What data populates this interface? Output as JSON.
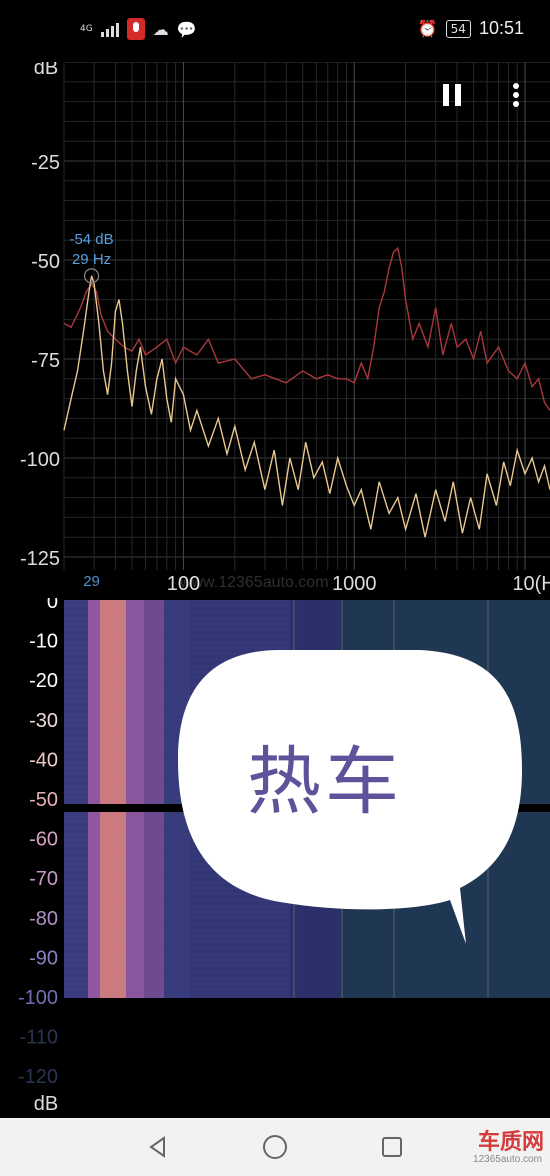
{
  "status_bar": {
    "network": "4G",
    "battery": "54",
    "time": "10:51",
    "icons": [
      "signal-icon",
      "recorder-icon",
      "qq-icon",
      "wechat-icon",
      "alarm-icon"
    ]
  },
  "toolbar": {
    "pause_icon": "pause-icon",
    "menu_icon": "more-vert-icon"
  },
  "chart_data": {
    "type": "line",
    "ylabel": "dB",
    "yticks": [
      "-25",
      "-50",
      "-75",
      "-100",
      "-125"
    ],
    "ylim": [
      0,
      -130
    ],
    "xscale": "log",
    "xticks": [
      "100",
      "1000",
      "10(Hz"
    ],
    "xlim_hz": [
      20,
      14000
    ],
    "grid": true,
    "peak": {
      "db_label": "-54 dB",
      "hz_label": "29 Hz",
      "freq_hz": 29,
      "db": -54,
      "axis_marker": "29"
    },
    "series": [
      {
        "color": "#a8383d",
        "points": [
          [
            20,
            -66
          ],
          [
            22,
            -67
          ],
          [
            25,
            -62
          ],
          [
            27,
            -58
          ],
          [
            29,
            -56
          ],
          [
            31,
            -58
          ],
          [
            33,
            -64
          ],
          [
            36,
            -68
          ],
          [
            40,
            -70
          ],
          [
            45,
            -72
          ],
          [
            50,
            -73
          ],
          [
            55,
            -70
          ],
          [
            60,
            -74
          ],
          [
            70,
            -72
          ],
          [
            80,
            -70
          ],
          [
            90,
            -76
          ],
          [
            100,
            -72
          ],
          [
            120,
            -74
          ],
          [
            140,
            -70
          ],
          [
            160,
            -76
          ],
          [
            200,
            -75
          ],
          [
            250,
            -80
          ],
          [
            300,
            -79
          ],
          [
            400,
            -81
          ],
          [
            500,
            -78
          ],
          [
            600,
            -80
          ],
          [
            700,
            -79
          ],
          [
            800,
            -80
          ],
          [
            900,
            -80
          ],
          [
            1000,
            -81
          ],
          [
            1100,
            -76
          ],
          [
            1200,
            -80
          ],
          [
            1300,
            -72
          ],
          [
            1400,
            -62
          ],
          [
            1500,
            -58
          ],
          [
            1600,
            -52
          ],
          [
            1700,
            -48
          ],
          [
            1800,
            -47
          ],
          [
            1900,
            -52
          ],
          [
            2000,
            -60
          ],
          [
            2200,
            -70
          ],
          [
            2400,
            -66
          ],
          [
            2700,
            -72
          ],
          [
            3000,
            -62
          ],
          [
            3300,
            -74
          ],
          [
            3700,
            -66
          ],
          [
            4000,
            -72
          ],
          [
            4500,
            -70
          ],
          [
            5000,
            -75
          ],
          [
            5500,
            -68
          ],
          [
            6000,
            -76
          ],
          [
            7000,
            -72
          ],
          [
            8000,
            -78
          ],
          [
            9000,
            -80
          ],
          [
            10000,
            -76
          ],
          [
            11000,
            -82
          ],
          [
            12000,
            -80
          ],
          [
            13000,
            -86
          ],
          [
            14000,
            -88
          ]
        ]
      },
      {
        "color": "#e8c890",
        "points": [
          [
            20,
            -93
          ],
          [
            22,
            -85
          ],
          [
            24,
            -78
          ],
          [
            26,
            -68
          ],
          [
            28,
            -58
          ],
          [
            29,
            -54
          ],
          [
            30,
            -56
          ],
          [
            32,
            -66
          ],
          [
            34,
            -78
          ],
          [
            36,
            -84
          ],
          [
            38,
            -76
          ],
          [
            40,
            -63
          ],
          [
            42,
            -60
          ],
          [
            44,
            -66
          ],
          [
            47,
            -78
          ],
          [
            50,
            -87
          ],
          [
            53,
            -78
          ],
          [
            56,
            -72
          ],
          [
            60,
            -82
          ],
          [
            65,
            -89
          ],
          [
            70,
            -80
          ],
          [
            75,
            -75
          ],
          [
            80,
            -85
          ],
          [
            85,
            -91
          ],
          [
            90,
            -80
          ],
          [
            100,
            -84
          ],
          [
            110,
            -93
          ],
          [
            120,
            -88
          ],
          [
            140,
            -97
          ],
          [
            160,
            -90
          ],
          [
            180,
            -99
          ],
          [
            200,
            -92
          ],
          [
            230,
            -103
          ],
          [
            260,
            -96
          ],
          [
            300,
            -108
          ],
          [
            340,
            -98
          ],
          [
            380,
            -112
          ],
          [
            420,
            -100
          ],
          [
            470,
            -108
          ],
          [
            520,
            -96
          ],
          [
            580,
            -105
          ],
          [
            650,
            -101
          ],
          [
            720,
            -109
          ],
          [
            800,
            -100
          ],
          [
            900,
            -107
          ],
          [
            1000,
            -112
          ],
          [
            1100,
            -108
          ],
          [
            1250,
            -118
          ],
          [
            1400,
            -106
          ],
          [
            1600,
            -114
          ],
          [
            1800,
            -110
          ],
          [
            2000,
            -118
          ],
          [
            2300,
            -109
          ],
          [
            2600,
            -120
          ],
          [
            3000,
            -108
          ],
          [
            3400,
            -116
          ],
          [
            3800,
            -106
          ],
          [
            4300,
            -119
          ],
          [
            4800,
            -110
          ],
          [
            5400,
            -118
          ],
          [
            6000,
            -104
          ],
          [
            6800,
            -112
          ],
          [
            7500,
            -101
          ],
          [
            8200,
            -107
          ],
          [
            9000,
            -98
          ],
          [
            10000,
            -104
          ],
          [
            11000,
            -100
          ],
          [
            12000,
            -106
          ],
          [
            13000,
            -102
          ],
          [
            14000,
            -108
          ]
        ]
      }
    ]
  },
  "spectrogram": {
    "ylabel": "dB",
    "scale_ticks": [
      "0",
      "-10",
      "-20",
      "-30",
      "-40",
      "-50",
      "-60",
      "-70",
      "-80",
      "-90",
      "-100",
      "-110",
      "-120"
    ],
    "band_colors": [
      "#3a3e80",
      "#d4807e",
      "#9a5ca6",
      "#2c2f6a",
      "#1b3b4a"
    ]
  },
  "overlay": {
    "bubble_text": "热车",
    "watermark": "www.12365auto.com"
  },
  "nav_bar": {
    "back_icon": "back-icon",
    "home_icon": "home-icon",
    "recents_icon": "recents-icon",
    "brand_logo": "车质网",
    "brand_url": "12365auto.com"
  }
}
